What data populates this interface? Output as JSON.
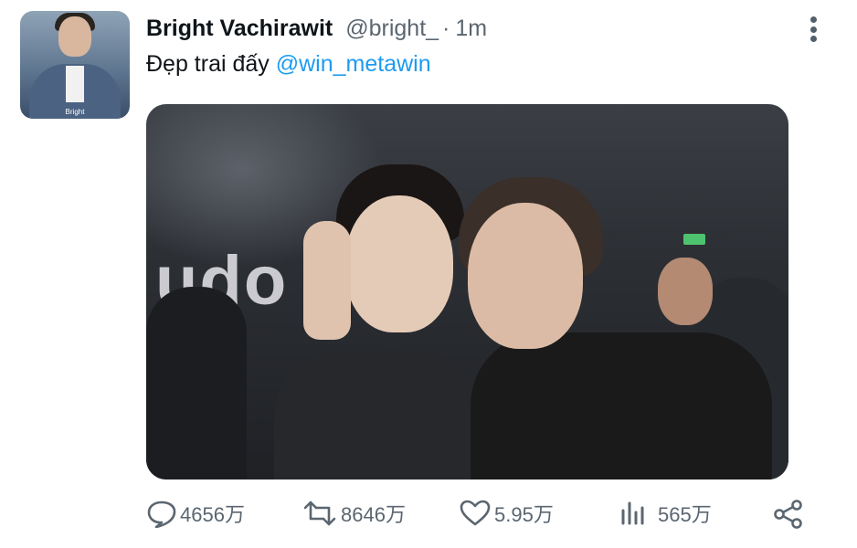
{
  "tweet": {
    "author_name": "Bright Vachirawit",
    "handle": "@bright_",
    "separator": "·",
    "time": "1m",
    "text": "Đẹp trai đấy ",
    "mention": "@win_metawin",
    "avatar_caption": "Bright"
  },
  "media": {
    "sign_text": "udo"
  },
  "actions": {
    "replies": "4656万",
    "retweets": "8646万",
    "likes": "5.95万",
    "views": "565万"
  },
  "icons": {
    "reply": "reply-icon",
    "retweet": "retweet-icon",
    "like": "heart-icon",
    "views": "views-icon",
    "share": "share-icon",
    "more": "more-vertical-icon"
  },
  "colors": {
    "text": "#0f1419",
    "secondary": "#5b6670",
    "link": "#1d9bf0"
  }
}
